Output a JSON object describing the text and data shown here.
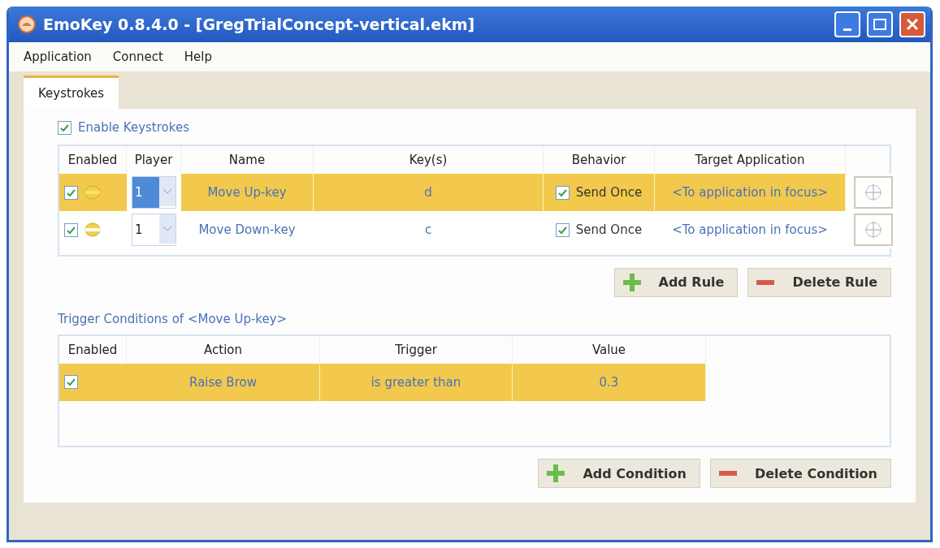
{
  "window": {
    "title": "EmoKey 0.8.4.0 - [GregTrialConcept-vertical.ekm]"
  },
  "menu": [
    "Application",
    "Connect",
    "Help"
  ],
  "tabs": [
    {
      "label": "Keystrokes",
      "selected": true
    }
  ],
  "enable_keystrokes": {
    "label": "Enable Keystrokes",
    "checked": true
  },
  "rules": {
    "columns": [
      "Enabled",
      "Player",
      "Name",
      "Key(s)",
      "Behavior",
      "Target Application"
    ],
    "rows": [
      {
        "selected": true,
        "enabled": true,
        "player": "1",
        "name": "Move Up-key",
        "keys": "d",
        "send_once": true,
        "behavior": "Send Once",
        "target": "<To application in focus>"
      },
      {
        "selected": false,
        "enabled": true,
        "player": "1",
        "name": "Move Down-key",
        "keys": "c",
        "send_once": true,
        "behavior": "Send Once",
        "target": "<To application in focus>"
      }
    ]
  },
  "rule_buttons": [
    {
      "kind": "add",
      "label": "Add Rule"
    },
    {
      "kind": "delete",
      "label": "Delete Rule"
    }
  ],
  "conditions": {
    "title": "Trigger Conditions of <Move Up-key>",
    "columns": [
      "Enabled",
      "Action",
      "Trigger",
      "Value"
    ],
    "rows": [
      {
        "selected": true,
        "enabled": true,
        "action": "Raise Brow",
        "trigger": "is greater than",
        "value": "0.3"
      }
    ]
  },
  "condition_buttons": [
    {
      "kind": "add",
      "label": "Add Condition"
    },
    {
      "kind": "delete",
      "label": "Delete Condition"
    }
  ]
}
